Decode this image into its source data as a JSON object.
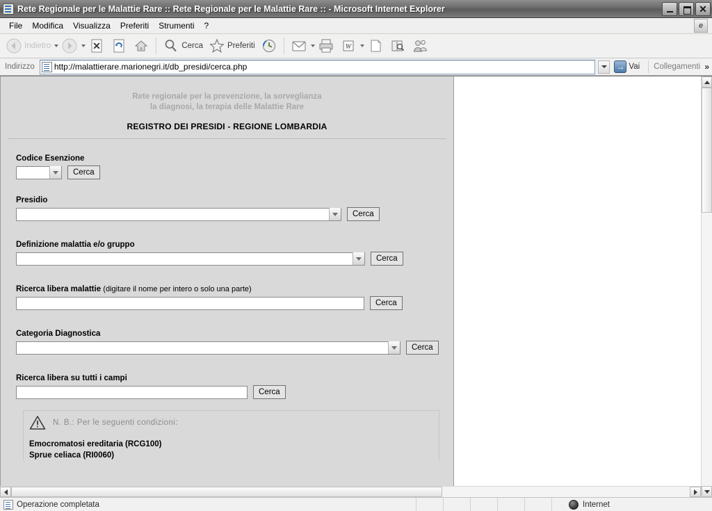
{
  "window": {
    "title": "Rete Regionale per le Malattie Rare :: Rete Regionale per le Malattie Rare :: - Microsoft Internet Explorer",
    "minimize_label": "Riduci a icona",
    "restore_label": "Ripristina",
    "close_label": "Chiudi"
  },
  "menu": {
    "items": [
      {
        "label": "File"
      },
      {
        "label": "Modifica"
      },
      {
        "label": "Visualizza"
      },
      {
        "label": "Preferiti"
      },
      {
        "label": "Strumenti"
      },
      {
        "label": "?"
      }
    ],
    "logo_text": "e"
  },
  "toolbar": {
    "back_label": "Indietro",
    "forward_label": "",
    "stop_label": "",
    "refresh_label": "",
    "home_label": "",
    "search_label": "Cerca",
    "favorites_label": "Preferiti",
    "history_label": "",
    "mail_label": "",
    "print_label": "",
    "edit_label": "",
    "discuss_label": "",
    "research_label": "",
    "messenger_label": ""
  },
  "address": {
    "label": "Indirizzo",
    "url": "http://malattierare.marionegri.it/db_presidi/cerca.php",
    "go_label": "Vai",
    "go_glyph": "→",
    "links_label": "Collegamenti",
    "overflow_glyph": "»"
  },
  "page": {
    "header": {
      "subtitle_line1": "Rete regionale per la prevenzione, la sorveglianza",
      "subtitle_line2": "la diagnosi, la terapia delle Malattie Rare",
      "title": "REGISTRO DEI PRESIDI - REGIONE LOMBARDIA"
    },
    "fields": [
      {
        "label": "Codice Esenzione",
        "label_hint": "",
        "control": "select",
        "value": "",
        "button": "Cerca"
      },
      {
        "label": "Presidio",
        "label_hint": "",
        "control": "select",
        "value": "",
        "button": "Cerca"
      },
      {
        "label": "Definizione malattia e/o gruppo",
        "label_hint": "",
        "control": "select",
        "value": "",
        "button": "Cerca"
      },
      {
        "label": "Ricerca libera malattie",
        "label_hint": "(digitare il nome per intero o solo una parte)",
        "control": "text",
        "value": "",
        "button": "Cerca"
      },
      {
        "label": "Categoria Diagnostica",
        "label_hint": "",
        "control": "select",
        "value": "",
        "button": "Cerca"
      },
      {
        "label": "Ricerca libera su tutti i campi",
        "label_hint": "",
        "control": "text",
        "value": "",
        "button": "Cerca"
      }
    ],
    "notice": {
      "text": "N. B.: Per le seguenti condizioni:",
      "items": [
        "Emocromatosi ereditaria (RCG100)",
        "Sprue celiaca (RI0060)"
      ]
    }
  },
  "statusbar": {
    "message": "Operazione completata",
    "zone": "Internet"
  }
}
